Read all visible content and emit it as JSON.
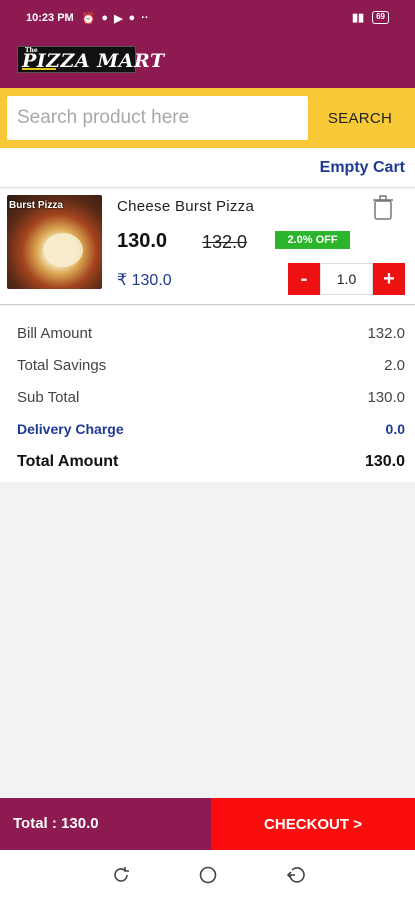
{
  "status_bar": {
    "time": "10:23 PM",
    "battery": "69"
  },
  "logo": {
    "the": "The",
    "brand": "PIZZA MART"
  },
  "search": {
    "placeholder": "Search product here",
    "value": "",
    "button_label": "SEARCH"
  },
  "cart": {
    "empty_label": "Empty Cart"
  },
  "item": {
    "name": "Cheese Burst Pizza",
    "thumb_caption": "Burst Pizza",
    "price": "130.0",
    "old_price": "132.0",
    "discount": "2.0% OFF",
    "rupee_price": "₹ 130.0",
    "minus_label": "-",
    "qty": "1.0",
    "plus_label": "+"
  },
  "bill": {
    "rows": [
      {
        "label": "Bill Amount",
        "value": "132.0"
      },
      {
        "label": "Total Savings",
        "value": "2.0"
      },
      {
        "label": "Sub Total",
        "value": "130.0"
      },
      {
        "label": "Delivery Charge",
        "value": "0.0"
      },
      {
        "label": "Total Amount",
        "value": "130.0"
      }
    ]
  },
  "footer": {
    "total_label": "Total : 130.0",
    "checkout_label": "CHECKOUT >"
  },
  "colors": {
    "brand": "#8e1a52",
    "accent": "#f7c936",
    "checkout": "#fc0d0d",
    "link": "#1f3a93",
    "badge": "#2bb52b"
  }
}
